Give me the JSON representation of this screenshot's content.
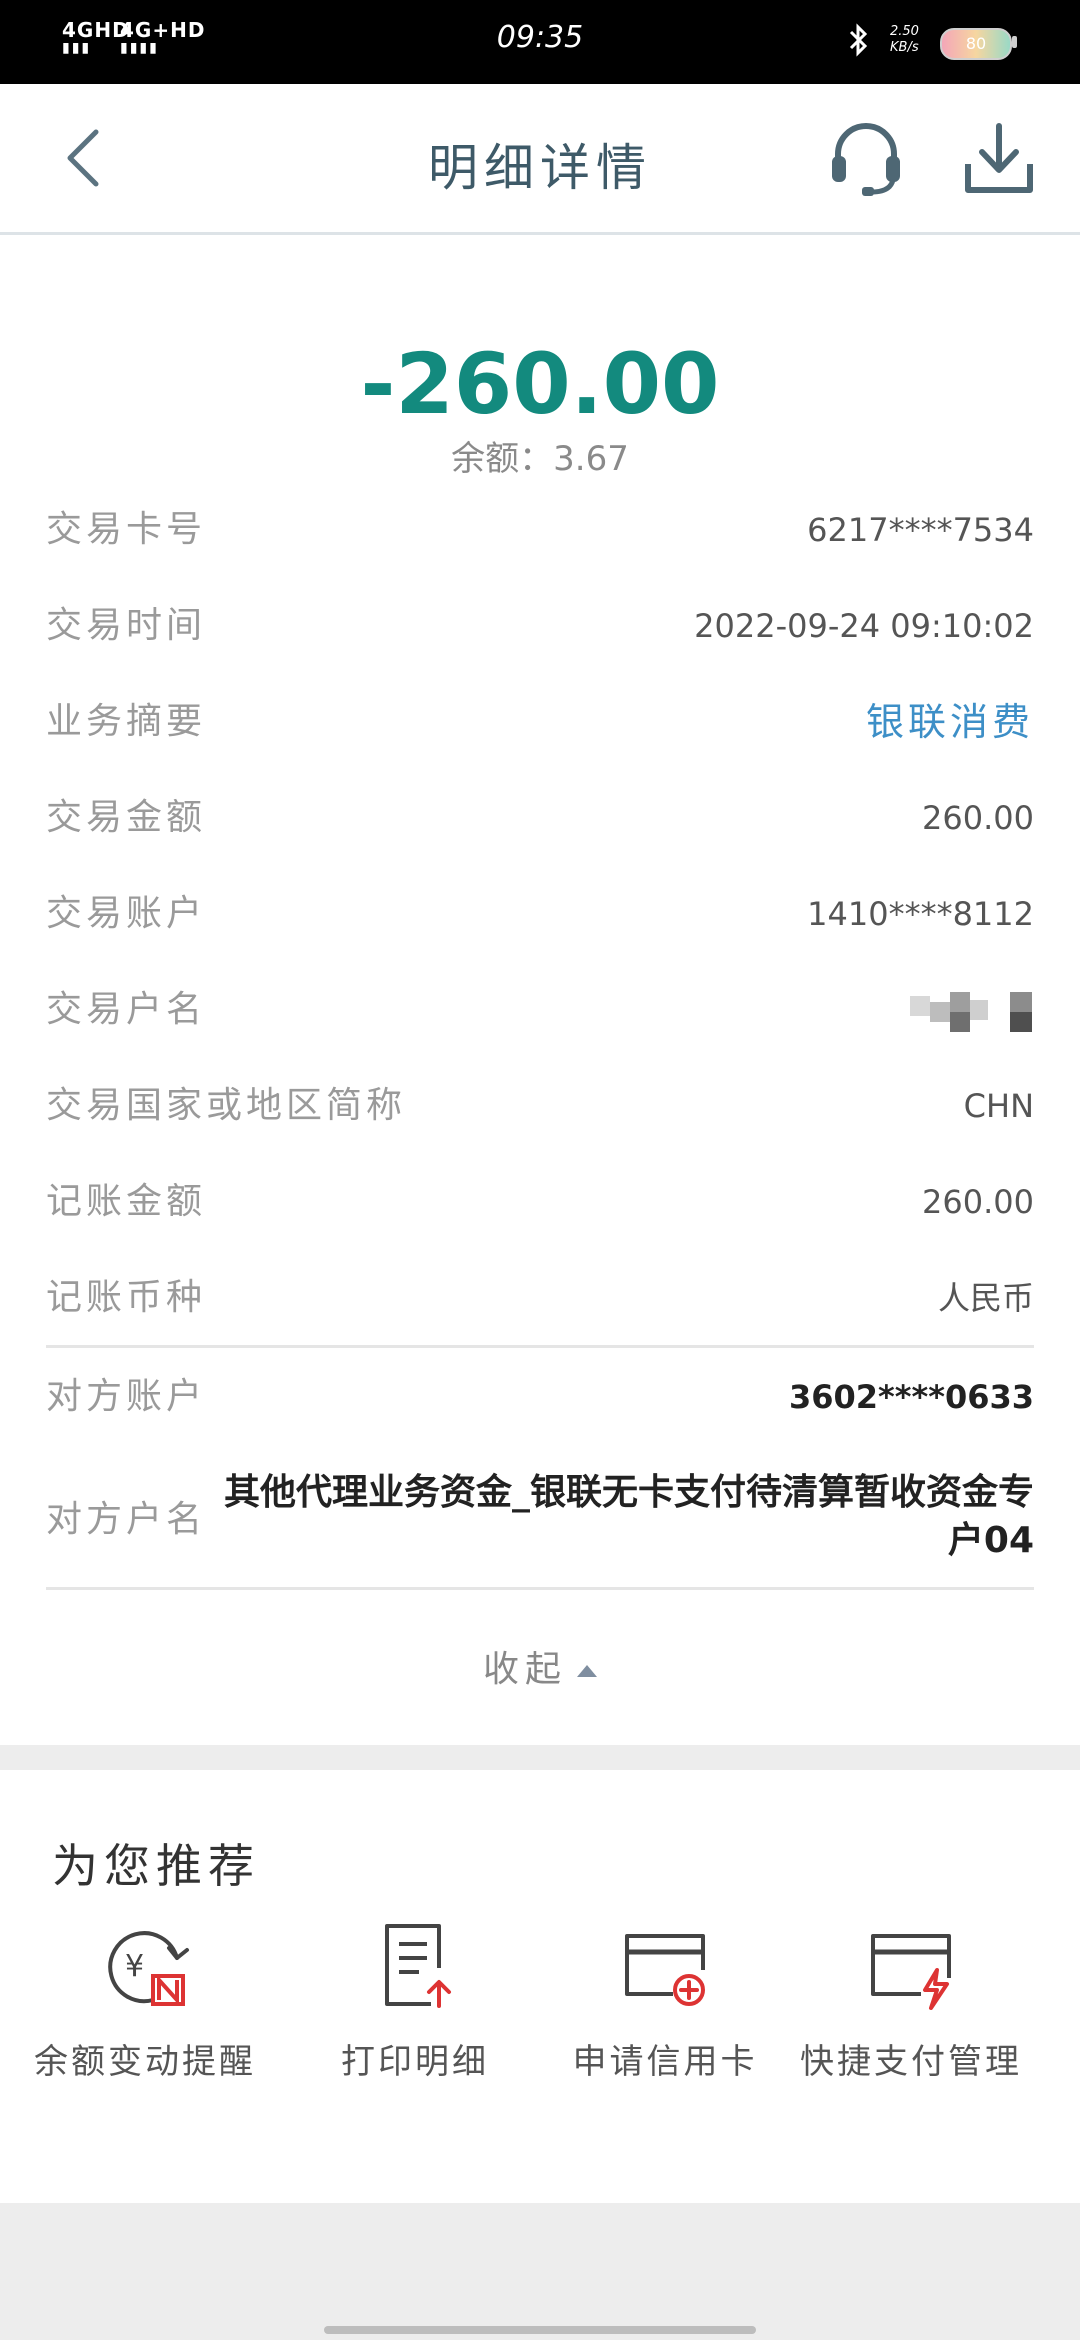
{
  "status_bar": {
    "signal1": "4GHD",
    "signal2": "4G+HD",
    "time": "09:35",
    "speed_value": "2.50",
    "speed_unit": "KB/s",
    "battery": "80"
  },
  "header": {
    "title": "明细详情"
  },
  "summary": {
    "amount": "-260.00",
    "balance": "余额：3.67",
    "accent_color": "#138a7e"
  },
  "details": [
    {
      "label": "交易卡号",
      "value": "6217****7534"
    },
    {
      "label": "交易时间",
      "value": "2022-09-24 09:10:02"
    },
    {
      "label": "业务摘要",
      "value": "银联消费"
    },
    {
      "label": "交易金额",
      "value": "260.00"
    },
    {
      "label": "交易账户",
      "value": "1410****8112"
    },
    {
      "label": "交易户名",
      "value": ""
    },
    {
      "label": "交易国家或地区简称",
      "value": "CHN"
    },
    {
      "label": "记账金额",
      "value": "260.00"
    },
    {
      "label": "记账币种",
      "value": "人民币"
    }
  ],
  "counterparty": [
    {
      "label": "对方账户",
      "value": "3602****0633"
    },
    {
      "label": "对方户名",
      "value": "其他代理业务资金_银联无卡支付待清算暂收资金专户04"
    }
  ],
  "collapse_label": "收起",
  "recommend": {
    "title": "为您推荐",
    "items": [
      {
        "label": "余额变动提醒",
        "icon": "balance-alert-icon"
      },
      {
        "label": "打印明细",
        "icon": "print-detail-icon"
      },
      {
        "label": "申请信用卡",
        "icon": "apply-card-icon"
      },
      {
        "label": "快捷支付管理",
        "icon": "quick-pay-icon"
      }
    ]
  }
}
